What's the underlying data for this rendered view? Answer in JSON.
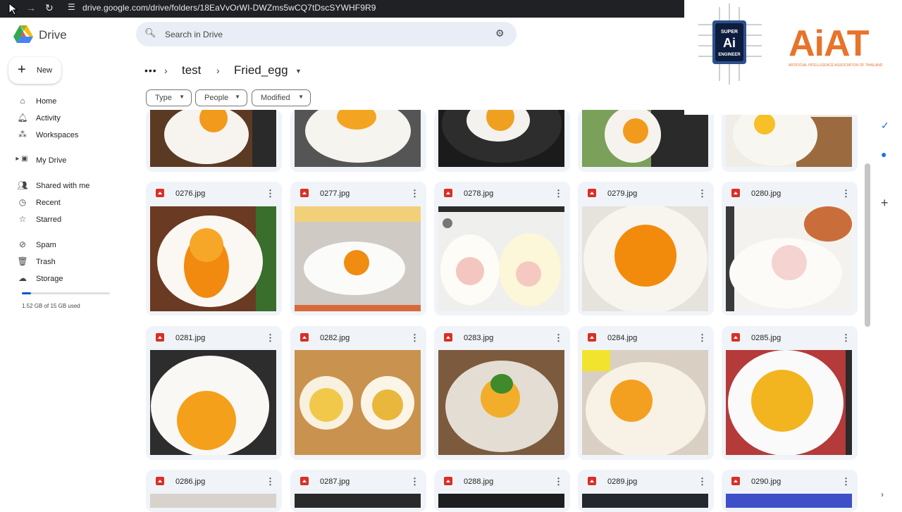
{
  "browser": {
    "back": "←",
    "forward": "→",
    "reload": "↻",
    "url": "drive.google.com/drive/folders/18EaVvOrWI-DWZms5wCQ7tDscSYWHF9R9"
  },
  "app": {
    "name": "Drive"
  },
  "new_button": {
    "label": "New"
  },
  "sidebar": {
    "items": [
      {
        "label": "Home"
      },
      {
        "label": "Activity"
      },
      {
        "label": "Workspaces"
      },
      {
        "label": "My Drive"
      },
      {
        "label": "Shared with me"
      },
      {
        "label": "Recent"
      },
      {
        "label": "Starred"
      },
      {
        "label": "Spam"
      },
      {
        "label": "Trash"
      },
      {
        "label": "Storage"
      }
    ],
    "storage_used_fraction": 0.101,
    "storage_text": "1.52 GB of 15 GB used"
  },
  "search": {
    "placeholder": "Search in Drive"
  },
  "breadcrumb": {
    "overflow": "•••",
    "items": [
      "test",
      "Fried_egg"
    ]
  },
  "filters": [
    "Type",
    "People",
    "Modified"
  ],
  "logos": {
    "super_ai": "SUPER AI ENGINEER",
    "aiat": "AiAT",
    "aiat_sub": "ARTIFICIAL INTELLIGENCE ASSOCIATION OF THAILAND"
  },
  "files": {
    "row1": [
      "0276.jpg",
      "0277.jpg",
      "0278.jpg",
      "0279.jpg",
      "0280.jpg"
    ],
    "row2": [
      "0281.jpg",
      "0282.jpg",
      "0283.jpg",
      "0284.jpg",
      "0285.jpg"
    ],
    "row3": [
      "0286.jpg",
      "0287.jpg",
      "0288.jpg",
      "0289.jpg",
      "0290.jpg"
    ]
  },
  "more_icon": "⋮",
  "colors": {
    "accent": "#0b57d0",
    "file_icon": "#d93025",
    "card_bg": "#f0f4f9",
    "aiat": "#e8732a"
  }
}
